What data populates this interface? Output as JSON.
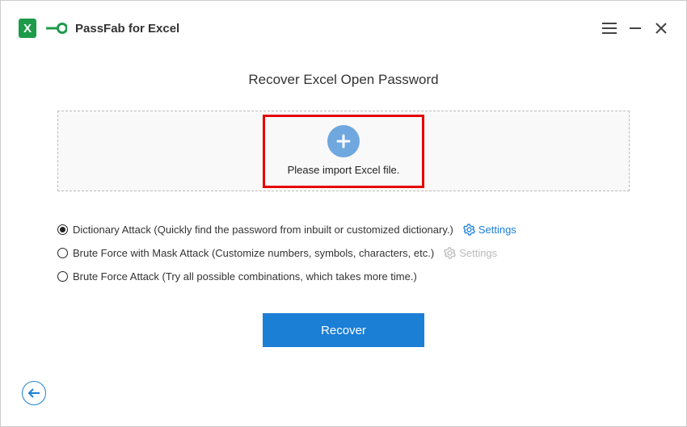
{
  "app": {
    "title": "PassFab for Excel"
  },
  "main": {
    "heading": "Recover Excel Open Password",
    "import_label": "Please import Excel file."
  },
  "options": [
    {
      "label": "Dictionary Attack (Quickly find the password from inbuilt or customized dictionary.)",
      "selected": true,
      "settings": "active"
    },
    {
      "label": "Brute Force with Mask Attack (Customize numbers, symbols, characters, etc.)",
      "selected": false,
      "settings": "disabled"
    },
    {
      "label": "Brute Force Attack (Try all possible combinations, which takes more time.)",
      "selected": false,
      "settings": "none"
    }
  ],
  "settings_label": "Settings",
  "buttons": {
    "recover": "Recover"
  }
}
